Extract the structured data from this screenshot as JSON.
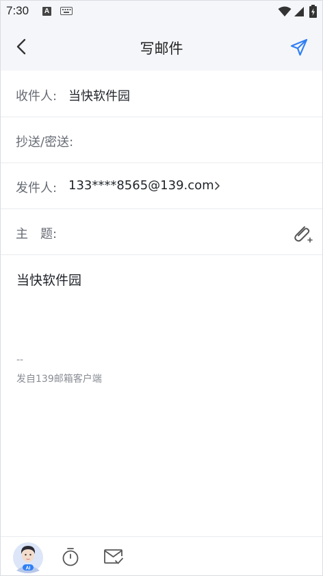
{
  "status_bar": {
    "time": "7:30",
    "indicator_a": "A"
  },
  "header": {
    "title": "写邮件"
  },
  "form": {
    "recipient_label": "收件人:",
    "recipient_value": "当快软件园",
    "cc_bcc_label": "抄送/密送:",
    "sender_label": "发件人:",
    "sender_value": "133****8565@139.com",
    "subject_label": "主　题:"
  },
  "body": {
    "text": "当快软件园",
    "signature_dash": "--",
    "signature_text": "发自139邮箱客户端"
  },
  "toolbar": {
    "ai_badge": "AI"
  },
  "colors": {
    "accent": "#2f7ff5",
    "header_bg": "#f5f6fa",
    "label": "#666a73",
    "text": "#1f2329",
    "signature": "#888c94"
  },
  "icons": [
    "back-arrow-icon",
    "send-icon",
    "chevron-right-icon",
    "attachment-icon",
    "ai-avatar-icon",
    "timer-icon",
    "receipt-envelope-icon",
    "wifi-icon",
    "signal-icon",
    "battery-icon",
    "keyboard-icon"
  ]
}
